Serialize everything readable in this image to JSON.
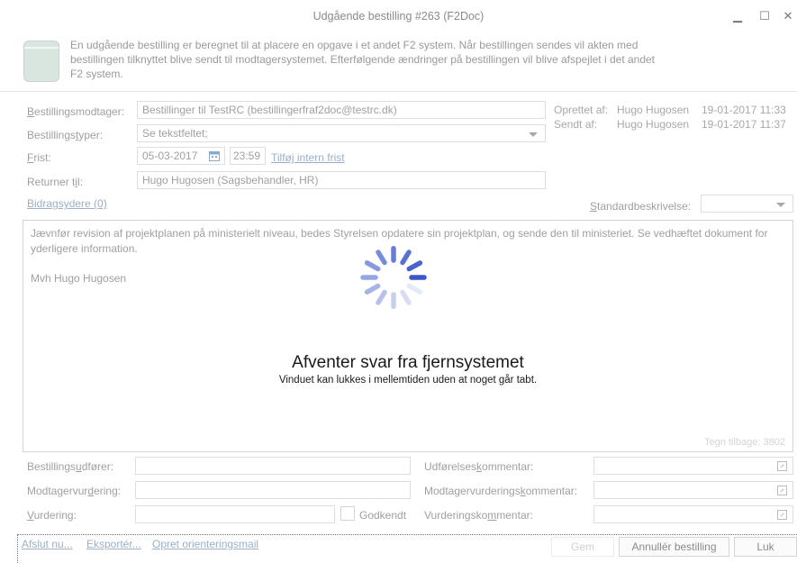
{
  "window": {
    "title": "Udgående bestilling #263 (F2Doc)",
    "minimize_glyph": "▁",
    "maximize_glyph": "☐",
    "close_glyph": "✕"
  },
  "info": {
    "icon": "document-icon",
    "text": "En udgående bestilling er beregnet til at placere en opgave i et andet F2 system. Når bestillingen sendes vil akten med bestillingen tilknyttet blive sendt til modtagersystemet. Efterfølgende ændringer på bestillingen vil blive afspejlet i det andet F2 system."
  },
  "form": {
    "recipient_label_u": "B",
    "recipient_label_rest": "estillingsmodtager:",
    "recipient_value": "Bestillinger til TestRC (bestillingerfraf2doc@testrc.dk)",
    "types_label_pre": "Bestillings",
    "types_label_u": "t",
    "types_label_rest": "yper:",
    "types_value": "Se tekstfeltet;",
    "deadline_label_u": "F",
    "deadline_label_rest": "rist:",
    "deadline_date": "05-03-2017",
    "deadline_time": "23:59",
    "add_internal_deadline": "Tilføj intern frist",
    "return_label_pre": "Returner t",
    "return_label_u": "i",
    "return_label_rest": "l:",
    "return_value": "Hugo Hugosen (Sagsbehandler, HR)",
    "contributors_link": "Bidragsydere (0)",
    "std_desc_label_u": "S",
    "std_desc_label_rest": "tandardbeskrivelse:",
    "std_desc_value": ""
  },
  "meta": {
    "created_label": "Oprettet af:",
    "created_by": "Hugo Hugosen",
    "created_at": "19-01-2017 11:33",
    "sent_label": "Sendt af:",
    "sent_by": "Hugo Hugosen",
    "sent_at": "19-01-2017 11:37"
  },
  "body": {
    "text": "Jævnfør revision af projektplanen på ministerielt niveau, bedes Styrelsen opdatere sin projektplan, og sende den til ministeriet. Se vedhæftet dokument for yderligere information.",
    "signature": "Mvh Hugo Hugosen",
    "char_count": "Tegn tilbage: 3802"
  },
  "overlay": {
    "title": "Afventer svar fra fjernsystemet",
    "subtitle": "Vinduet kan lukkes i mellemtiden uden at noget går tabt.",
    "spinner_color": "#3a56c8"
  },
  "lower": {
    "executor_label_pre": "Bestillings",
    "executor_label_u": "u",
    "executor_label_rest": "dfører:",
    "executor_value": "",
    "exec_comment_label_pre": "Udførelses",
    "exec_comment_label_u": "k",
    "exec_comment_label_rest": "ommentar:",
    "exec_comment_value": "",
    "recv_eval_label_pre": "Modtagervur",
    "recv_eval_label_u": "d",
    "recv_eval_label_rest": "ering:",
    "recv_eval_value": "",
    "recv_eval_comment_label_pre": "Modtagervurderings",
    "recv_eval_comment_label_u": "k",
    "recv_eval_comment_label_rest": "ommentar:",
    "recv_eval_comment_value": "",
    "eval_label_u": "V",
    "eval_label_rest": "urdering:",
    "eval_value": "",
    "approved_label": "Godkendt",
    "eval_comment_label_pre": "Vurderingsko",
    "eval_comment_label_u": "m",
    "eval_comment_label_rest": "mentar:",
    "eval_comment_value": ""
  },
  "footer": {
    "finish_link": "Afslut nu...",
    "export_link": "Eksportér...",
    "orientation_link": "Opret orienteringsmail",
    "save_button": "Gem",
    "cancel_order_button": "Annullér bestilling",
    "close_button": "Luk"
  }
}
